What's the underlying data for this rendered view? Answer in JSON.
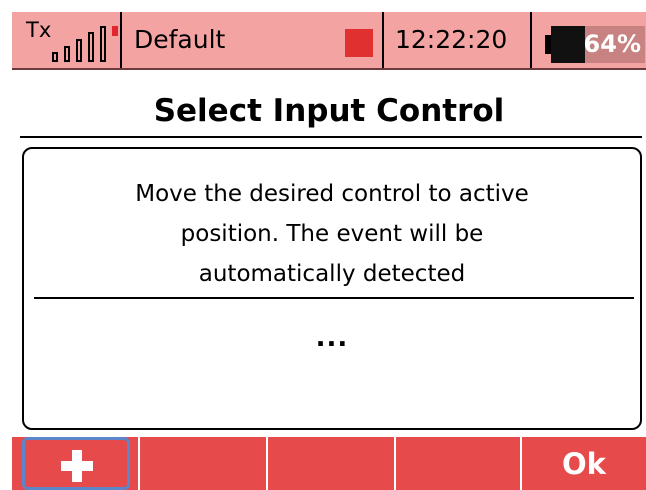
{
  "status_bar": {
    "tx_label": "Tx",
    "model_name": "Default",
    "time": "12:22:20",
    "battery_percent_label": "64%",
    "battery_level": 0.64,
    "signal_bars": 4,
    "colors": {
      "background": "#f4a3a3",
      "indicator": "#e03030",
      "battery_fill": "#c98282"
    }
  },
  "page": {
    "title": "Select Input Control"
  },
  "dialog": {
    "message_lines": [
      "Move the desired control to active",
      "position. The event will be",
      "automatically detected"
    ],
    "status_text": "..."
  },
  "softkeys": {
    "buttons": [
      {
        "icon": "plus-icon",
        "label": ""
      },
      {
        "label": ""
      },
      {
        "label": ""
      },
      {
        "label": ""
      },
      {
        "label": "Ok"
      }
    ],
    "colors": {
      "background": "#e64a4a",
      "focus": "#5b86c9"
    }
  }
}
